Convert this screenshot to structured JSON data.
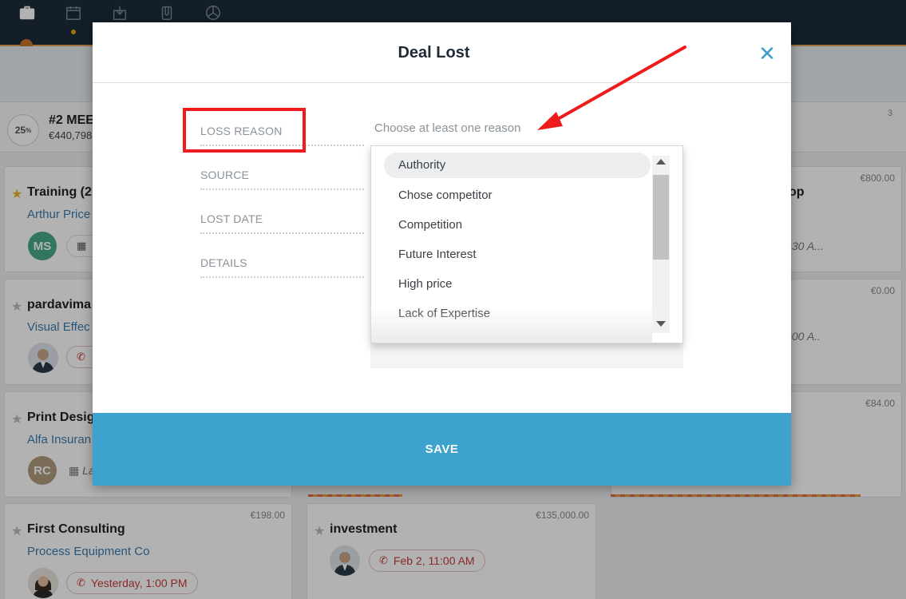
{
  "stage": {
    "percent": "25",
    "percent_sign": "%",
    "title": "#2 MEE",
    "amount": "€440,798",
    "count": "3"
  },
  "cards": [
    {
      "title": "Training (2",
      "company": "Arthur Price",
      "initials": "MS",
      "star": "gold"
    },
    {
      "title": "pardavima",
      "company": "Visual Effec"
    },
    {
      "title": "Print Desig",
      "company": "Alfa Insuran",
      "initials": "RC",
      "time": "La"
    },
    {
      "title": "First Consulting",
      "company": "Process Equipment Co",
      "price": "€198.00",
      "activity": "Yesterday, 1:00 PM"
    },
    {
      "title": "investment",
      "price": "€135,000.00",
      "activity": "Feb 2, 11:00 AM"
    },
    {
      "title": "op",
      "price": "€800.00",
      "time": ":30 A..."
    },
    {
      "price": "€0.00",
      "time": ":00 A.."
    },
    {
      "price": "€84.00"
    }
  ],
  "modal": {
    "title": "Deal Lost",
    "fields": {
      "loss_reason": "LOSS REASON",
      "source": "SOURCE",
      "lost_date": "LOST DATE",
      "details": "DETAILS"
    },
    "loss_reason_placeholder": "Choose at least one reason",
    "reasons": [
      "Authority",
      "Chose competitor",
      "Competition",
      "Future Interest",
      "High price",
      "Lack of Expertise"
    ],
    "save_label": "SAVE"
  },
  "colors": {
    "accent": "#3da2ce",
    "highlight": "#ee1c1c",
    "topbar": "#1c2b3b"
  }
}
